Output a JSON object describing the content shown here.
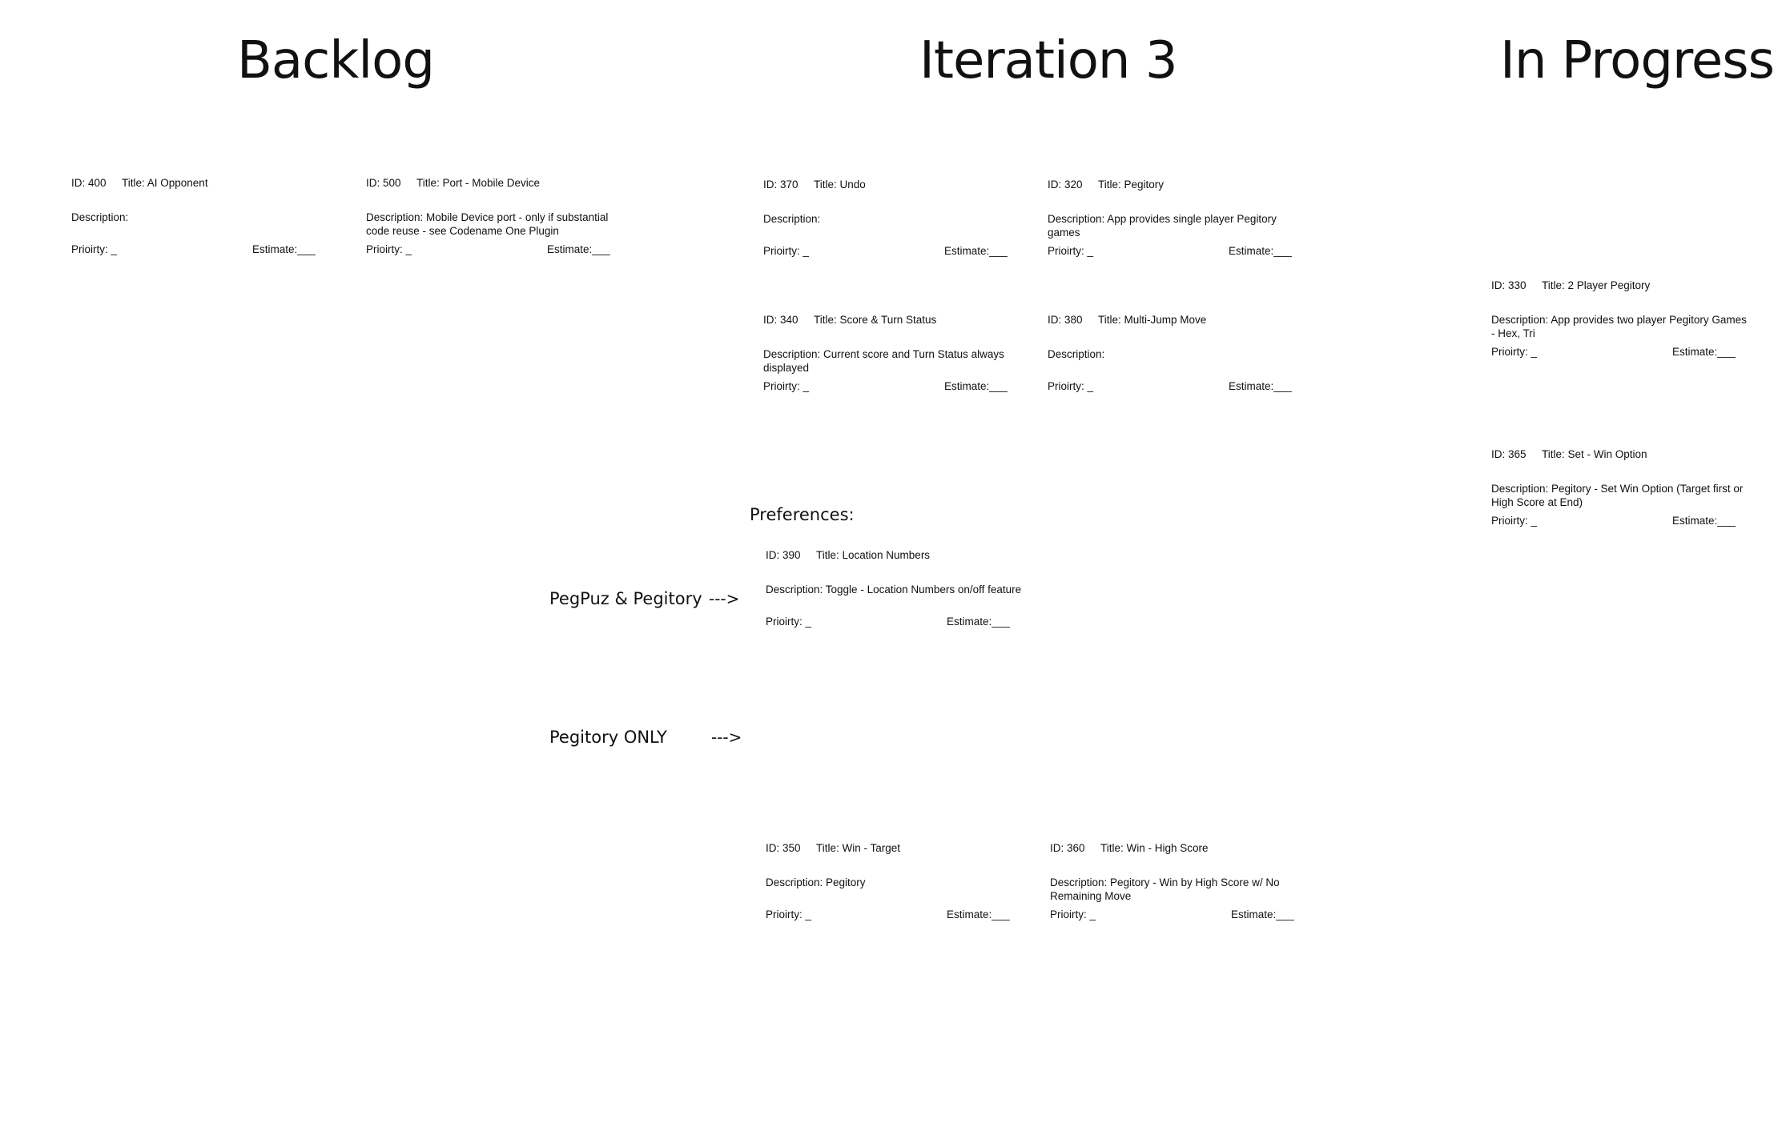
{
  "columns": {
    "backlog": "Backlog",
    "iteration": "Iteration 3",
    "in_progress": "In Progress"
  },
  "labels": {
    "preferences": "Preferences:",
    "pegpuz_pegitory": "PegPuz &  Pegitory",
    "pegitory_only": "Pegitory ONLY",
    "arrow": "--->"
  },
  "cards": {
    "c400": {
      "id": "ID: 400",
      "title": "Title: AI Opponent",
      "description": "Description:",
      "priority": "Prioirty: _",
      "estimate": "Estimate:___"
    },
    "c500": {
      "id": "ID: 500",
      "title": "Title: Port - Mobile Device",
      "description": "Description: Mobile Device port - only if substantial code reuse - see Codename One Plugin",
      "priority": "Prioirty: _",
      "estimate": "Estimate:___"
    },
    "c370": {
      "id": "ID: 370",
      "title": "Title: Undo",
      "description": "Description:",
      "priority": "Prioirty: _",
      "estimate": "Estimate:___"
    },
    "c320": {
      "id": "ID: 320",
      "title": "Title: Pegitory",
      "description": "Description: App provides single player Pegitory games",
      "priority": "Prioirty: _",
      "estimate": "Estimate:___"
    },
    "c340": {
      "id": "ID: 340",
      "title": "Title: Score & Turn Status",
      "description": "Description: Current score and Turn Status always displayed",
      "priority": "Prioirty: _",
      "estimate": "Estimate:___"
    },
    "c380": {
      "id": "ID: 380",
      "title": "Title: Multi-Jump Move",
      "description": "Description:",
      "priority": "Prioirty: _",
      "estimate": "Estimate:___"
    },
    "c390": {
      "id": "ID: 390",
      "title": "Title: Location Numbers",
      "description": "Description: Toggle - Location Numbers on/off feature",
      "priority": "Prioirty: _",
      "estimate": "Estimate:___"
    },
    "c350": {
      "id": "ID: 350",
      "title": "Title: Win - Target",
      "description": "Description:  Pegitory",
      "priority": "Prioirty: _",
      "estimate": "Estimate:___"
    },
    "c360": {
      "id": "ID: 360",
      "title": "Title: Win - High Score",
      "description": "Description: Pegitory - Win by High Score w/ No Remaining Move",
      "priority": "Prioirty: _",
      "estimate": "Estimate:___"
    },
    "c330": {
      "id": "ID: 330",
      "title": "Title: 2 Player Pegitory",
      "description": "Description: App provides two player Pegitory Games - Hex, Tri",
      "priority": "Prioirty: _",
      "estimate": "Estimate:___"
    },
    "c365": {
      "id": "ID: 365",
      "title": "Title: Set - Win Option",
      "description": "Description:  Pegitory - Set Win Option (Target first or High Score at End)",
      "priority": "Prioirty: _",
      "estimate": "Estimate:___"
    }
  }
}
